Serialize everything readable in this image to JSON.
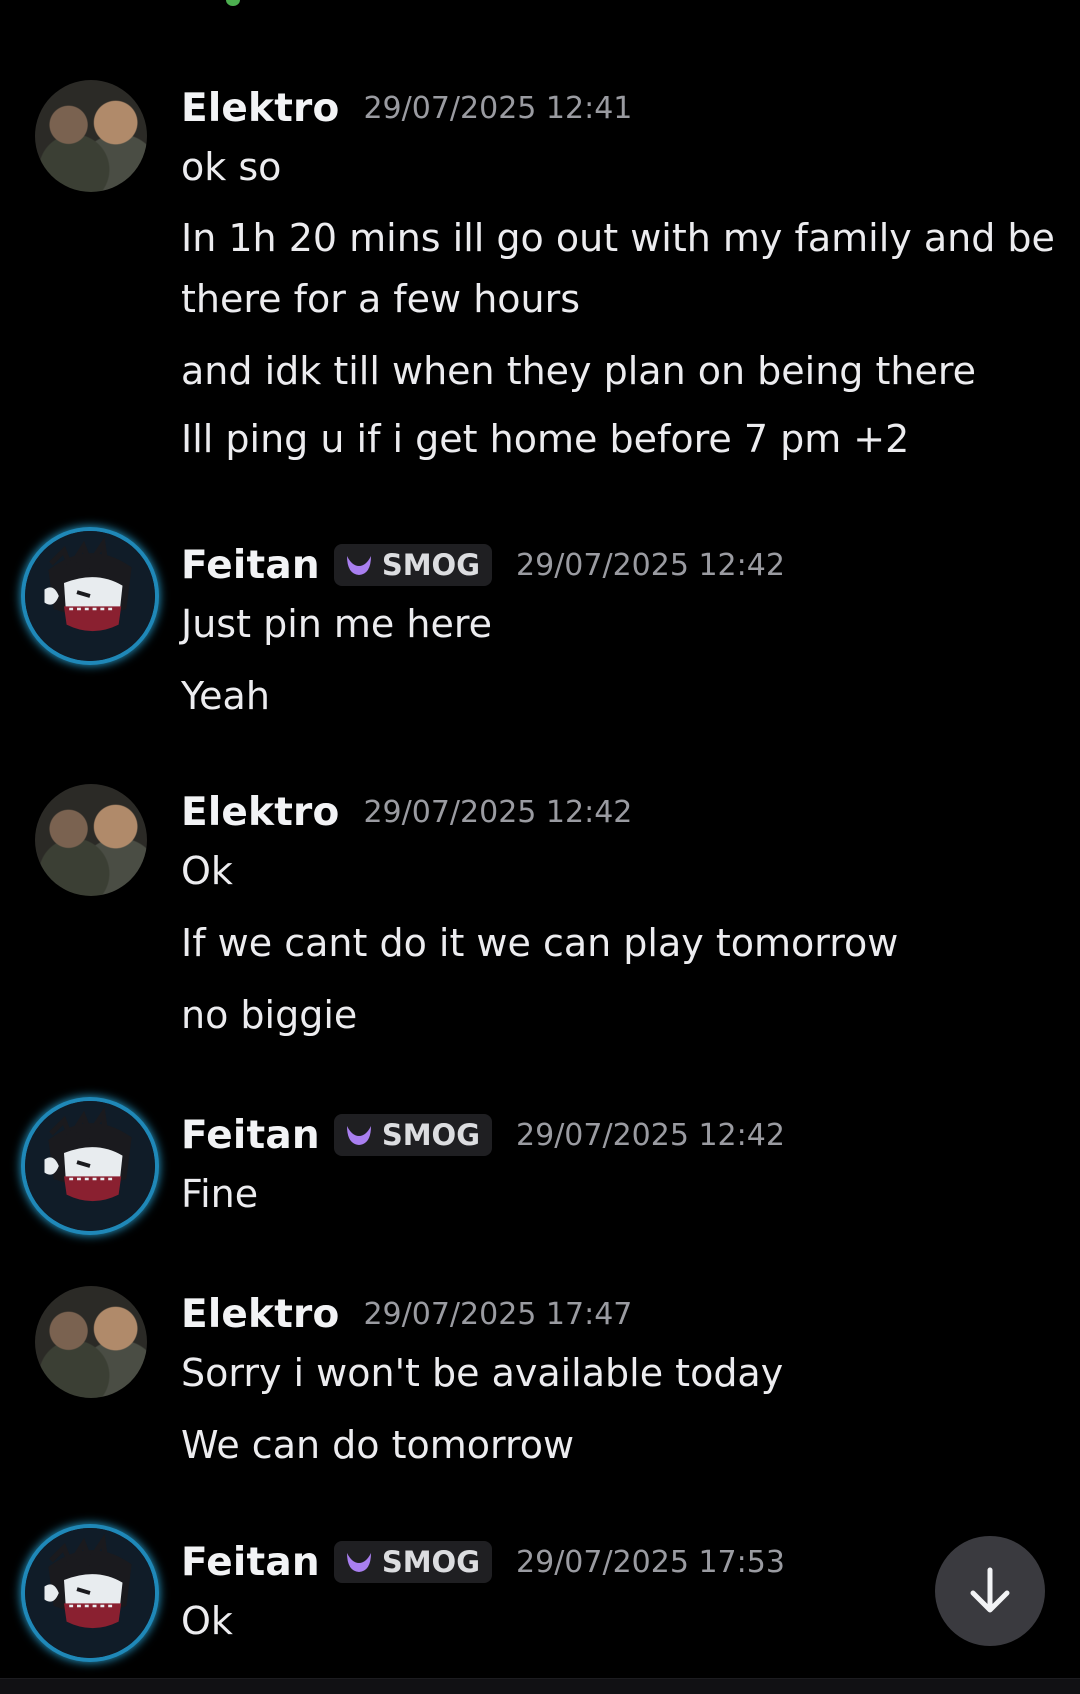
{
  "messages": [
    {
      "author": "Elektro",
      "timestamp": "29/07/2025 12:41",
      "lines": [
        "ok so",
        "In 1h 20 mins ill go out with my family and be",
        "there for a few hours",
        "and idk till when they plan on being there",
        "Ill ping u if i get home before 7 pm +2"
      ]
    },
    {
      "author": "Feitan",
      "tag": "SMOG",
      "timestamp": "29/07/2025 12:42",
      "lines": [
        "Just pin me here",
        "Yeah"
      ]
    },
    {
      "author": "Elektro",
      "timestamp": "29/07/2025 12:42",
      "lines": [
        "Ok",
        "If we cant do it we can play tomorrow",
        "no biggie"
      ]
    },
    {
      "author": "Feitan",
      "tag": "SMOG",
      "timestamp": "29/07/2025 12:42",
      "lines": [
        "Fine"
      ]
    },
    {
      "author": "Elektro",
      "timestamp": "29/07/2025 17:47",
      "lines": [
        "Sorry i won't be available today",
        "We can do tomorrow"
      ]
    },
    {
      "author": "Feitan",
      "tag": "SMOG",
      "timestamp": "29/07/2025 17:53",
      "lines": [
        "Ok"
      ]
    }
  ],
  "icons": {
    "scroll_down": "arrow-down-icon",
    "tag_icon": "crescent-icon"
  },
  "colors": {
    "background": "#000000",
    "tag_icon": "#a97ff0",
    "avatar_ring": "#2aa7d8",
    "scroll_button": "#3a3a3f"
  }
}
